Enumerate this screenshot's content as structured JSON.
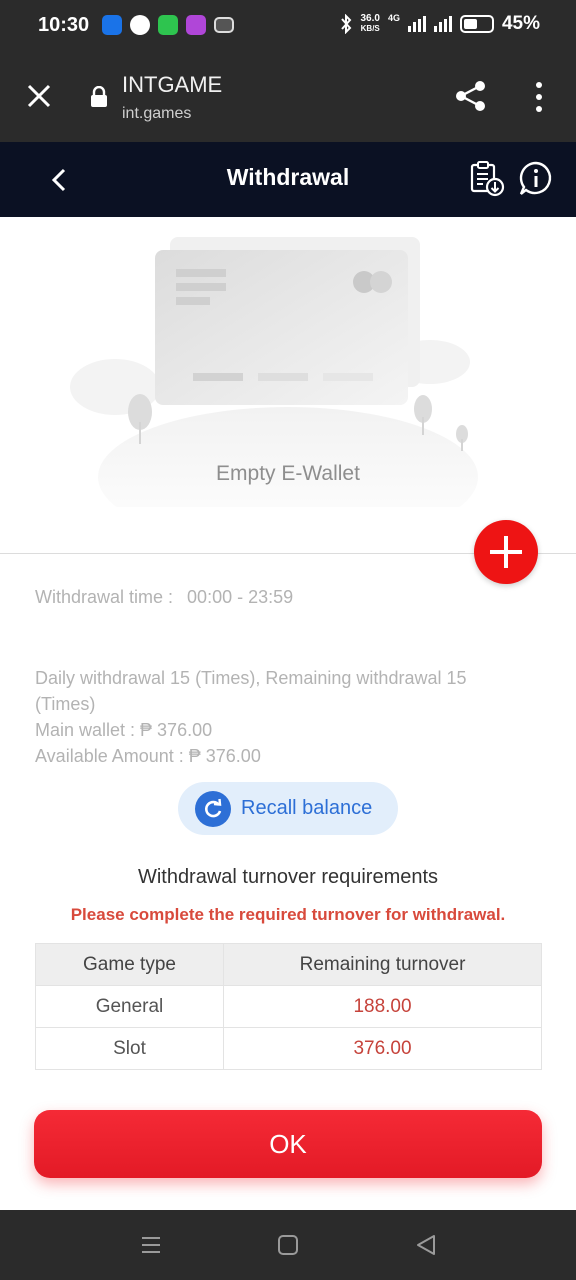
{
  "status_bar": {
    "time": "10:30",
    "net_speed_value": "36.0",
    "net_speed_unit": "KB/S",
    "network_type": "4G",
    "battery": "45%"
  },
  "browser": {
    "site_title": "INTGAME",
    "url": "int.games"
  },
  "header": {
    "title": "Withdrawal"
  },
  "empty_wallet": {
    "label": "Empty E-Wallet"
  },
  "withdrawal_info": {
    "time_label": "Withdrawal time :",
    "time_value": "00:00 - 23:59",
    "daily_text": "Daily withdrawal 15 (Times), Remaining withdrawal 15 (Times)",
    "main_wallet": "Main wallet : ₱ 376.00",
    "available_amount": "Available Amount : ₱ 376.00"
  },
  "recall": {
    "label": "Recall balance"
  },
  "turnover": {
    "title": "Withdrawal turnover requirements",
    "warning": "Please complete the required turnover for withdrawal.",
    "columns": [
      "Game type",
      "Remaining turnover"
    ],
    "rows": [
      {
        "type": "General",
        "remaining": "188.00"
      },
      {
        "type": "Slot",
        "remaining": "376.00"
      }
    ]
  },
  "ok_button": {
    "label": "OK"
  },
  "colors": {
    "primary_red": "#ee1414",
    "header_navy": "#0b1123",
    "recall_blue": "#2d6fd6",
    "warning_red": "#d84a3c"
  }
}
